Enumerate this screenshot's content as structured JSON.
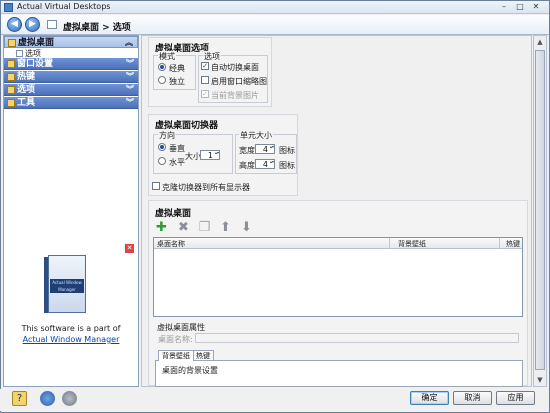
{
  "window": {
    "title": "Actual Virtual Desktops"
  },
  "nav": {
    "back": "◀",
    "forward": "▶",
    "breadcrumb": "虚拟桌面 > 选项"
  },
  "sidebar": {
    "groups": [
      {
        "label": "虚拟桌面",
        "chevron": "︽"
      },
      {
        "label": "窗口设置",
        "chevron": "︾"
      },
      {
        "label": "热键",
        "chevron": "︾"
      },
      {
        "label": "选项",
        "chevron": "︾"
      },
      {
        "label": "工具",
        "chevron": "︾"
      }
    ],
    "sub_item": "选项",
    "close_glyph": "✕",
    "box_band": "Actual Window Manager",
    "promo_text": "This software is a part of",
    "promo_link": "Actual Window Manager"
  },
  "options": {
    "title": "虚拟桌面选项",
    "mode_label": "模式",
    "mode_classic": "经典",
    "mode_independent": "独立",
    "opts_label": "选项",
    "auto_switch": "自动切换桌面",
    "enable_thumbs": "启用窗口缩略图",
    "show_bg": "当前背景图片",
    "check_glyph": "✓"
  },
  "switcher": {
    "title": "虚拟桌面切换器",
    "direction_label": "方向",
    "vertical": "垂直",
    "horizontal": "水平",
    "size_label": "大小",
    "size_value": "1",
    "cell_size_label": "单元大小",
    "width_label": "宽度",
    "width_value": "4",
    "height_label": "高度",
    "height_value": "4",
    "unit": "图标",
    "clone_all": "克隆切换器到所有显示器"
  },
  "desktops": {
    "title": "虚拟桌面",
    "icons": {
      "add": "✚",
      "delete": "✖",
      "copy": "❐",
      "up": "⬆",
      "down": "⬇"
    },
    "columns": [
      "桌面名称",
      "背景壁纸",
      "热键"
    ],
    "props_label": "虚拟桌面属性",
    "name_label": "桌面名称:",
    "tabs": [
      "背景壁纸",
      "热键"
    ],
    "bg_settings": "桌面的背景设置"
  },
  "footer": {
    "ok": "确定",
    "cancel": "取消",
    "apply": "应用"
  },
  "colors": {
    "accent": "#4c71b9",
    "active_group": "#a8c2e8"
  }
}
